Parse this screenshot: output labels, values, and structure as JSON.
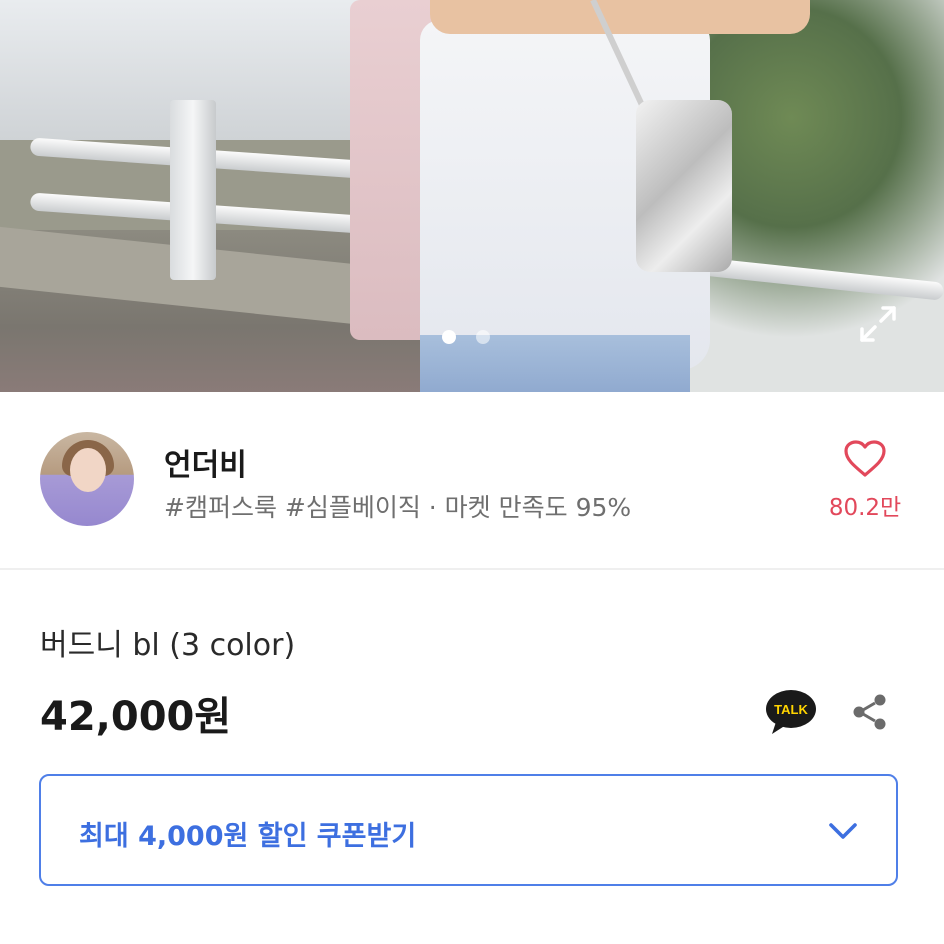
{
  "photo": {
    "slide_count": 2,
    "current_slide": 1,
    "expand_icon": "expand-icon"
  },
  "seller": {
    "name": "언더비",
    "tags": "#캠퍼스룩 #심플베이직 · 마켓 만족도 95%",
    "like_icon": "heart-outline-icon",
    "like_count": "80.2만"
  },
  "product": {
    "name": "버드니 bl (3 color)",
    "price": "42,000원"
  },
  "actions": {
    "talk_label": "TALK",
    "share_icon": "share-icon"
  },
  "coupon": {
    "label": "최대 4,000원 할인 쿠폰받기",
    "icon": "chevron-down-icon"
  },
  "colors": {
    "accent_blue": "#3d6fe0",
    "like_red": "#e2485b",
    "talk_yellow": "#ffd400"
  }
}
